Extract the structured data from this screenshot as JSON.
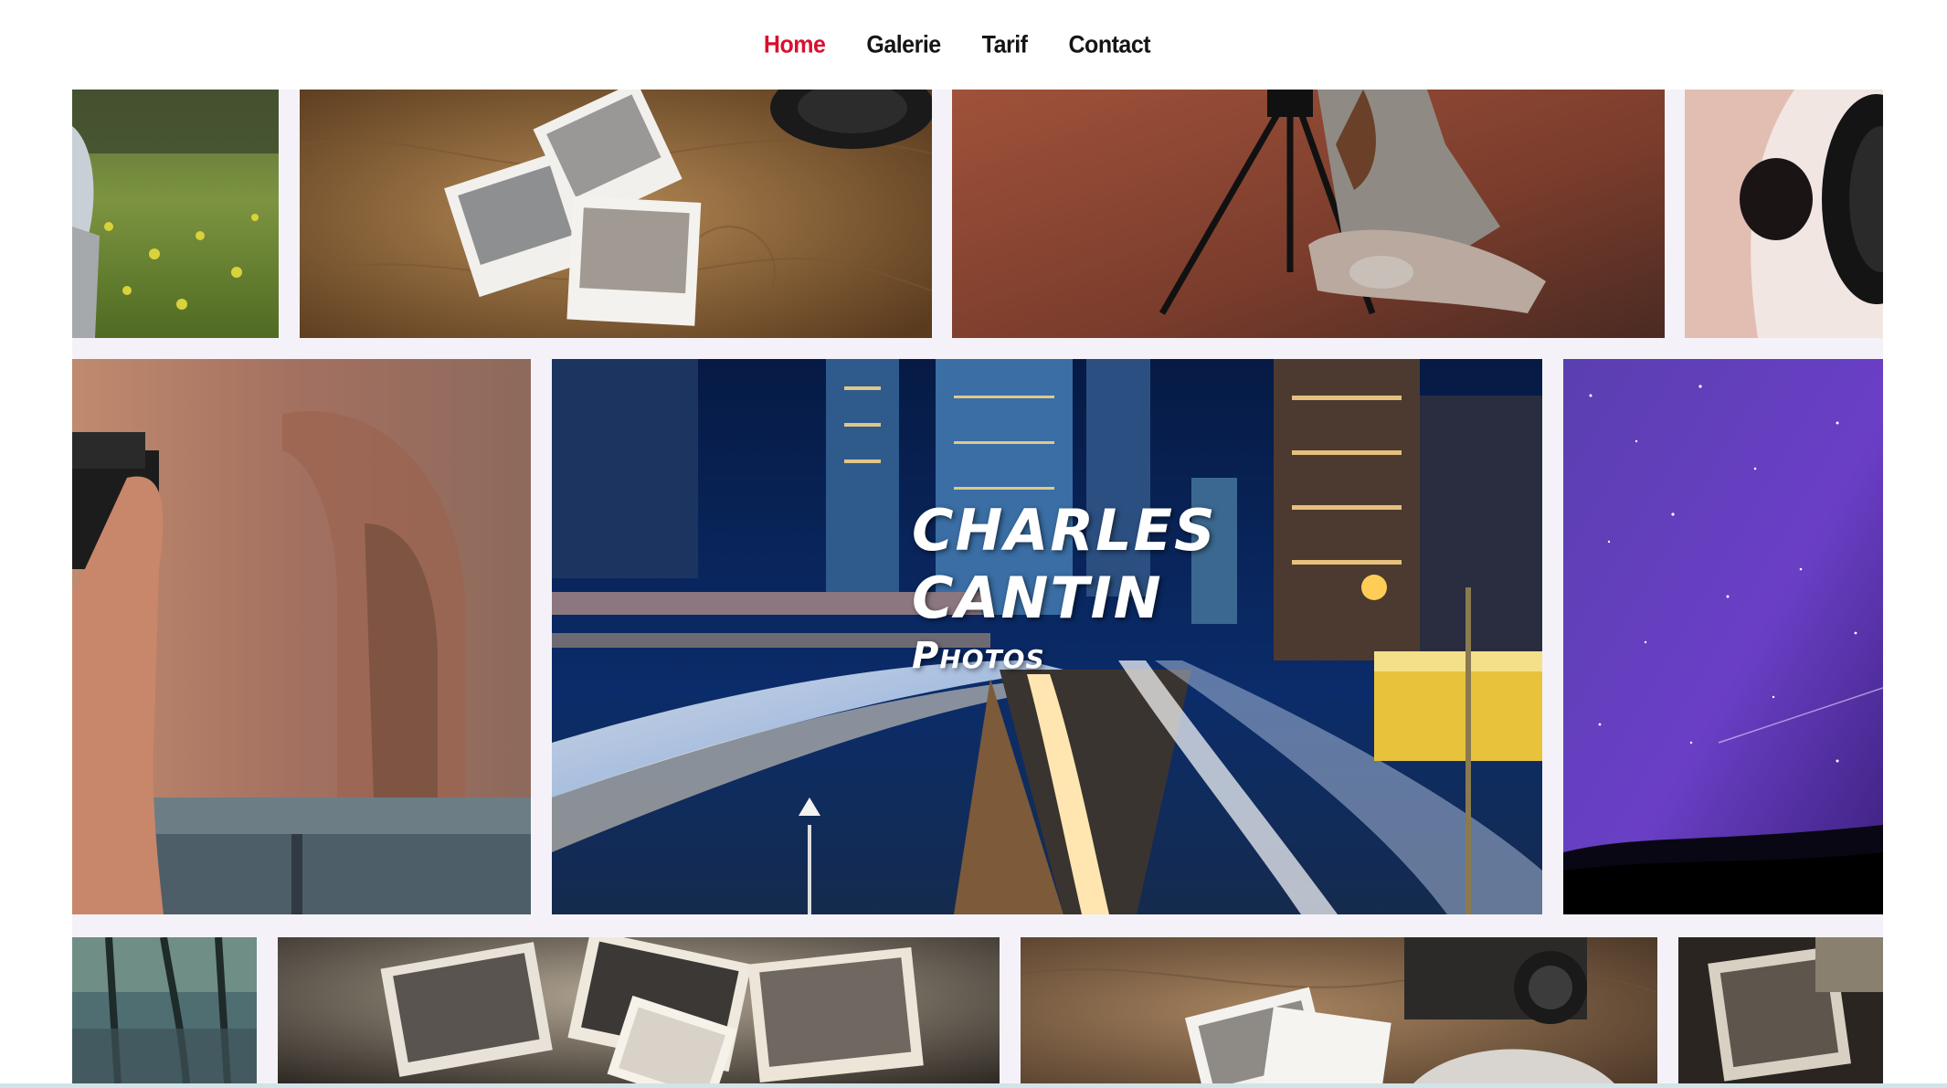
{
  "nav": {
    "items": [
      {
        "label": "Home",
        "active": true
      },
      {
        "label": "Galerie",
        "active": false
      },
      {
        "label": "Tarif",
        "active": false
      },
      {
        "label": "Contact",
        "active": false
      }
    ],
    "active_color": "#d8102f",
    "text_color": "#151515"
  },
  "hero": {
    "name_line1": "CHARLES",
    "name_line2": "CANTIN",
    "subtitle": "Photos"
  },
  "gallery": {
    "background": "#f4f2f8",
    "tiles": [
      {
        "subject": "grass-meadow-photo"
      },
      {
        "subject": "polaroids-on-map-photo"
      },
      {
        "subject": "girl-with-tripod-photo"
      },
      {
        "subject": "camera-lens-hand-photo"
      },
      {
        "subject": "photographer-with-camera-photo"
      },
      {
        "subject": "city-night-traffic-photo"
      },
      {
        "subject": "purple-starry-sky-photo"
      },
      {
        "subject": "trees-photo"
      },
      {
        "subject": "old-photographs-photo"
      },
      {
        "subject": "polaroids-and-camera-photo"
      },
      {
        "subject": "vintage-photo-closeup"
      }
    ]
  }
}
